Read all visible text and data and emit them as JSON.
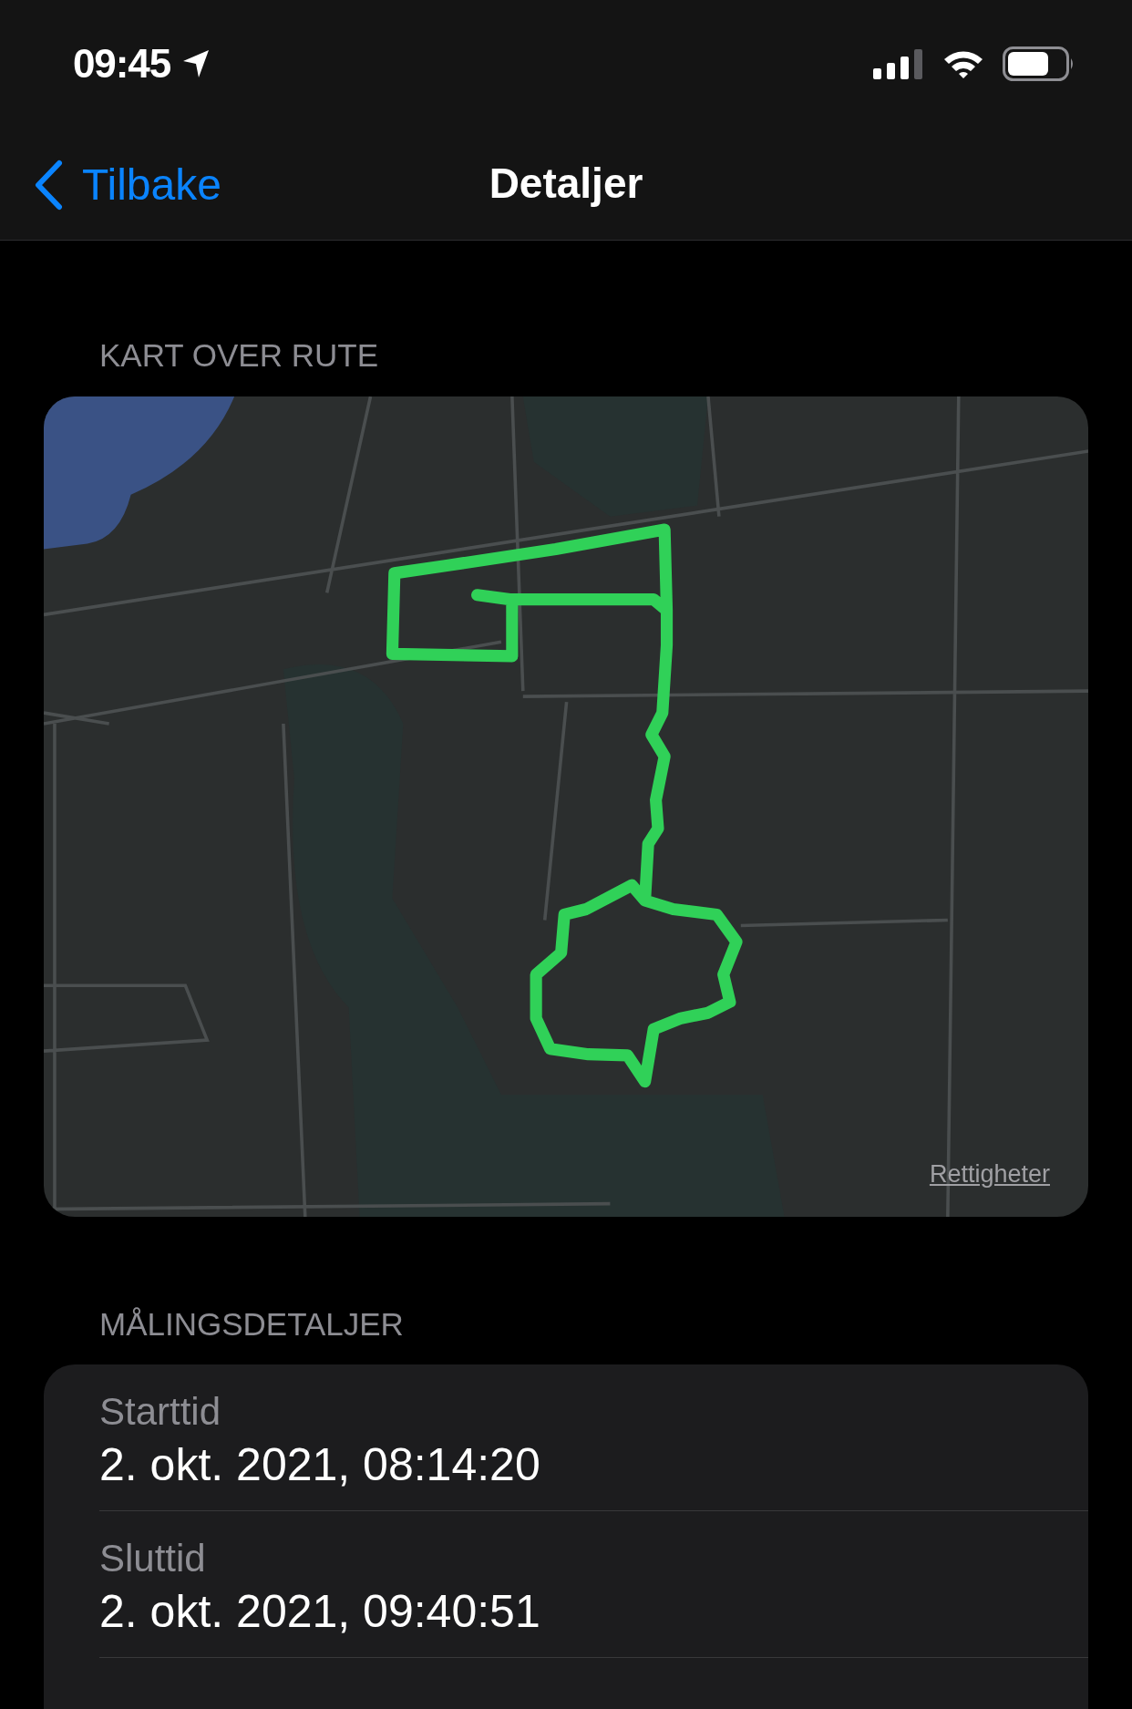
{
  "status_bar": {
    "time": "09:45"
  },
  "nav": {
    "back_label": "Tilbake",
    "title": "Detaljer"
  },
  "sections": [
    {
      "kind": "map",
      "header": "KART OVER RUTE",
      "legal_link": "Rettigheter"
    },
    {
      "kind": "list",
      "header": "MÅLINGSDETALJER",
      "rows": [
        {
          "label": "Starttid",
          "value": "2. okt. 2021, 08:14:20"
        },
        {
          "label": "Sluttid",
          "value": "2. okt. 2021, 09:40:51"
        }
      ]
    }
  ]
}
